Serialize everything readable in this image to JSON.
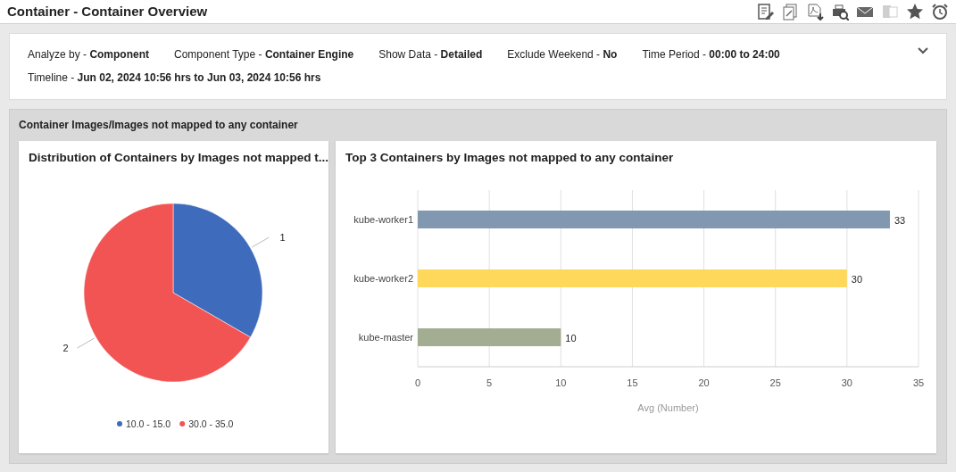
{
  "page": {
    "title": "Container - Container Overview"
  },
  "toolbar": [
    {
      "kind": "report",
      "disabled": false
    },
    {
      "kind": "documents",
      "disabled": false
    },
    {
      "kind": "pdf",
      "disabled": false
    },
    {
      "kind": "preview",
      "disabled": false
    },
    {
      "kind": "mail",
      "disabled": false
    },
    {
      "kind": "excel",
      "disabled": true
    },
    {
      "kind": "star",
      "disabled": false
    },
    {
      "kind": "alarm",
      "disabled": false
    }
  ],
  "filters": [
    {
      "label": "Analyze by - ",
      "value": "Component"
    },
    {
      "label": "Component Type - ",
      "value": "Container Engine"
    },
    {
      "label": "Show Data - ",
      "value": "Detailed"
    },
    {
      "label": "Exclude Weekend - ",
      "value": "No"
    },
    {
      "label": "Time Period - ",
      "value": "00:00 to 24:00"
    },
    {
      "label": "Timeline - ",
      "value": "Jun 02, 2024 10:56 hrs to Jun 03, 2024 10:56 hrs"
    }
  ],
  "section": {
    "title": "Container Images/Images not mapped to any container"
  },
  "pie_card": {
    "title": "Distribution of Containers by Images not mapped t...",
    "chart_data": {
      "type": "pie",
      "categories": [
        "10.0 - 15.0",
        "30.0 - 35.0"
      ],
      "values": [
        1,
        2
      ],
      "colors": [
        "#3e6bbb",
        "#f25454"
      ],
      "data_labels": true,
      "legend": "bottom"
    }
  },
  "bar_card": {
    "title": "Top 3 Containers by Images not mapped to any container",
    "chart_data": {
      "type": "bar",
      "orientation": "horizontal",
      "xlabel": "Avg (Number)",
      "categories": [
        "kube-worker1",
        "kube-worker2",
        "kube-master"
      ],
      "values": [
        33,
        30,
        10
      ],
      "colors": [
        "#8298b0",
        "#fed85a",
        "#a3ad91"
      ],
      "xlim": [
        0,
        35
      ],
      "xticks": [
        0,
        5,
        10,
        15,
        20,
        25,
        30,
        35
      ],
      "data_labels": true,
      "grid": true
    }
  }
}
